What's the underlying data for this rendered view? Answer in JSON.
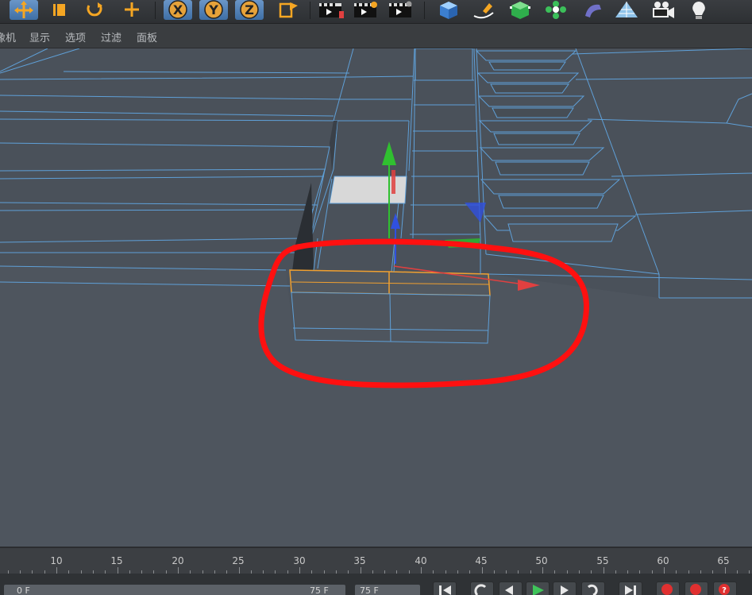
{
  "menu": {
    "items": [
      "摄像机",
      "显示",
      "选项",
      "过滤",
      "面板"
    ],
    "first_visible": "像机"
  },
  "toolbar": {
    "buttons": [
      {
        "name": "move-tool-icon",
        "active": true
      },
      {
        "name": "scale-tool-icon",
        "active": false
      },
      {
        "name": "rotate-tool-icon",
        "active": false
      },
      {
        "name": "last-tool-icon",
        "active": false
      },
      {
        "name": "x-axis-lock-icon",
        "active": true
      },
      {
        "name": "y-axis-lock-icon",
        "active": true
      },
      {
        "name": "z-axis-lock-icon",
        "active": true
      },
      {
        "name": "coordinate-system-icon",
        "active": false
      },
      {
        "name": "render-view-icon",
        "active": false
      },
      {
        "name": "render-picture-viewer-icon",
        "active": false
      },
      {
        "name": "render-settings-icon",
        "active": false
      },
      {
        "name": "cube-primitive-icon",
        "active": false
      },
      {
        "name": "spline-pen-icon",
        "active": false
      },
      {
        "name": "subdivision-surface-icon",
        "active": false
      },
      {
        "name": "cloner-icon",
        "active": false
      },
      {
        "name": "bend-deformer-icon",
        "active": false
      },
      {
        "name": "floor-icon",
        "active": false
      },
      {
        "name": "camera-icon",
        "active": false
      },
      {
        "name": "light-icon",
        "active": false
      }
    ]
  },
  "timeline": {
    "ticks": [
      10,
      15,
      20,
      25,
      30,
      35,
      40,
      45,
      50,
      55,
      60,
      65
    ]
  },
  "bottom": {
    "start_field": "0 F",
    "range_end": "75 F",
    "end_field": "75 F"
  },
  "colors": {
    "viewport_bg": "#4c535c",
    "wireframe": "#5fa0d8",
    "selection": "#f0a030",
    "annotation": "#ff1010",
    "axis_x": "#e04040",
    "axis_y": "#30c030",
    "axis_z": "#3050e0"
  }
}
